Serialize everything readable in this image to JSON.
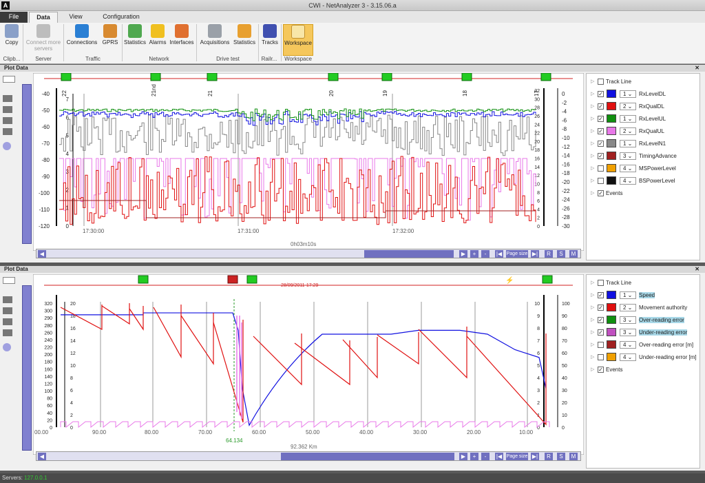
{
  "window": {
    "title": "CWI - NetAnalyzer 3 - 3.15.06.a",
    "logo": "A"
  },
  "menu_tabs": [
    "File",
    "Data",
    "View",
    "Configuration"
  ],
  "ribbon": {
    "buttons": [
      "Copy",
      "Connect more servers",
      "Connections",
      "GPRS",
      "Statistics",
      "Alarms",
      "Interfaces",
      "Acquisitions",
      "Statistics",
      "Tracks",
      "Workspace"
    ],
    "groups": [
      "Clipb...",
      "Server",
      "Traffic",
      "Network",
      "Drive test",
      "Railr...",
      "Workspace"
    ]
  },
  "panel1": {
    "title": "Plot Data",
    "time_ticks": [
      "17:30:00",
      "17:31:00",
      "17:32:00"
    ],
    "left_axis_ticks": [
      "-40",
      "-50",
      "-60",
      "-70",
      "-80",
      "-90",
      "-100",
      "-110",
      "-120"
    ],
    "inner_left_ticks": [
      "7",
      "6",
      "5",
      "4",
      "3",
      "2",
      "1",
      "0"
    ],
    "right_axis_a": [
      "0",
      "-2",
      "-4",
      "-6",
      "-8",
      "-10",
      "-12",
      "-14",
      "-16",
      "-18",
      "-20",
      "-22",
      "-24",
      "-26",
      "-28",
      "-30"
    ],
    "right_axis_b": [
      "32",
      "30",
      "28",
      "26",
      "24",
      "22",
      "20",
      "18",
      "16",
      "14",
      "12",
      "10",
      "8",
      "6",
      "4",
      "2",
      "0"
    ],
    "cell_labels": [
      "22",
      "21nd",
      "21",
      "20",
      "19",
      "18",
      "17"
    ],
    "duration": "0h03m10s",
    "page_size": "Page size",
    "legend": [
      {
        "label": "Track Line",
        "checked": false,
        "color": "",
        "width": ""
      },
      {
        "label": "RxLevelDL",
        "checked": true,
        "color": "#1010e0",
        "width": "1"
      },
      {
        "label": "RxQualDL",
        "checked": true,
        "color": "#e01010",
        "width": "2"
      },
      {
        "label": "RxLevelUL",
        "checked": true,
        "color": "#109010",
        "width": "1"
      },
      {
        "label": "RxQualUL",
        "checked": true,
        "color": "#e878e8",
        "width": "2"
      },
      {
        "label": "RxLevelN1",
        "checked": true,
        "color": "#888888",
        "width": "1"
      },
      {
        "label": "TimingAdvance",
        "checked": true,
        "color": "#a02020",
        "width": "3"
      },
      {
        "label": "MSPowerLevel",
        "checked": false,
        "color": "#f0a000",
        "width": "4"
      },
      {
        "label": "BSPowerLevel",
        "checked": false,
        "color": "#111111",
        "width": "4"
      },
      {
        "label": "Events",
        "checked": true,
        "color": "",
        "width": ""
      }
    ]
  },
  "panel2": {
    "title": "Plot Data",
    "date_label": "28/09/2011-17:29",
    "left_axis_ticks": [
      "320",
      "300",
      "290",
      "280",
      "260",
      "240",
      "220",
      "200",
      "180",
      "160",
      "140",
      "120",
      "100",
      "80",
      "60",
      "40",
      "20",
      "0"
    ],
    "inner_left_ticks": [
      "20",
      "18",
      "16",
      "14",
      "12",
      "10",
      "8",
      "6",
      "4",
      "2",
      "0"
    ],
    "right_axis_a": [
      "10",
      "9",
      "8",
      "7",
      "6",
      "5",
      "4",
      "3",
      "2",
      "1",
      "0"
    ],
    "right_axis_b": [
      "100",
      "90",
      "80",
      "70",
      "60",
      "50",
      "40",
      "30",
      "20",
      "10",
      "0"
    ],
    "dist_ticks": [
      "00.00",
      "90.00",
      "80.00",
      "70.00",
      "60.00",
      "50.00",
      "40.00",
      "30.00",
      "20.00",
      "10.00"
    ],
    "marker": "64.134",
    "distance": "92.362 Km",
    "page_size": "Page size",
    "legend": [
      {
        "label": "Track Line",
        "checked": false,
        "color": "",
        "width": ""
      },
      {
        "label": "Speed",
        "checked": true,
        "color": "#1010e0",
        "width": "1",
        "hl": true
      },
      {
        "label": "Movement authority",
        "checked": true,
        "color": "#e01010",
        "width": "2"
      },
      {
        "label": "Over-reading error",
        "checked": true,
        "color": "#109010",
        "width": "3",
        "hl": true
      },
      {
        "label": "Under-reading error",
        "checked": true,
        "color": "#c050c0",
        "width": "3",
        "hl": true
      },
      {
        "label": "Over-reading error [m]",
        "checked": false,
        "color": "#a02020",
        "width": "4"
      },
      {
        "label": "Under-reading error [m]",
        "checked": false,
        "color": "#f0a000",
        "width": "4"
      },
      {
        "label": "Events",
        "checked": true,
        "color": "",
        "width": ""
      }
    ]
  },
  "statusbar": {
    "label": "Servers:",
    "value": "127.0.0.1"
  }
}
